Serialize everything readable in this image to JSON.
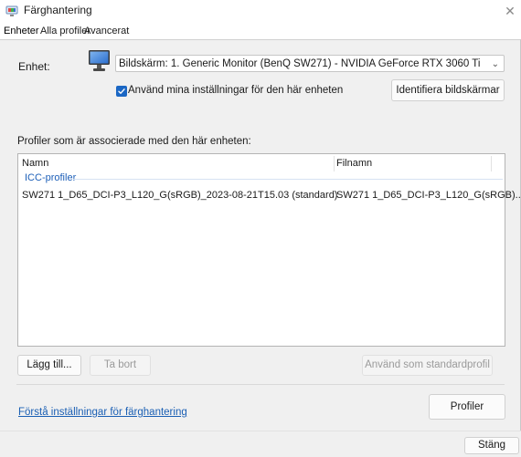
{
  "window": {
    "title": "Färghantering",
    "close_glyph": "✕"
  },
  "tabs": [
    {
      "label": "Enheter",
      "active": true
    },
    {
      "label": "Alla profiler",
      "active": false
    },
    {
      "label": "Avancerat",
      "active": false
    }
  ],
  "device": {
    "label": "Enhet:",
    "selected": "Bildskärm: 1. Generic Monitor (BenQ SW271) - NVIDIA GeForce RTX 3060 Ti",
    "chevron": "⌄",
    "use_settings_label": "Använd mina inställningar för den här enheten",
    "use_settings_checked": true,
    "identify_button": "Identifiera bildskärmar"
  },
  "profiles": {
    "label": "Profiler som är associerade med den här enheten:",
    "columns": [
      "Namn",
      "Filnamn"
    ],
    "group": "ICC-profiler",
    "rows": [
      {
        "name": "SW271 1_D65_DCI-P3_L120_G(sRGB)_2023-08-21T15.03 (standard)",
        "filename": "SW271 1_D65_DCI-P3_L120_G(sRGB)..."
      }
    ]
  },
  "actions": {
    "add": "Lägg till...",
    "remove": "Ta bort",
    "set_default": "Använd som standardprofil"
  },
  "footer": {
    "help_link": "Förstå inställningar för färghantering",
    "profiles_button": "Profiler",
    "close_button": "Stäng"
  },
  "icons": {
    "app": "color-management-icon",
    "monitor": "monitor-icon",
    "check": "checkmark-icon"
  },
  "colors": {
    "accent": "#1b67c4",
    "link": "#1a5fb4",
    "panel": "#f0f0f0"
  }
}
